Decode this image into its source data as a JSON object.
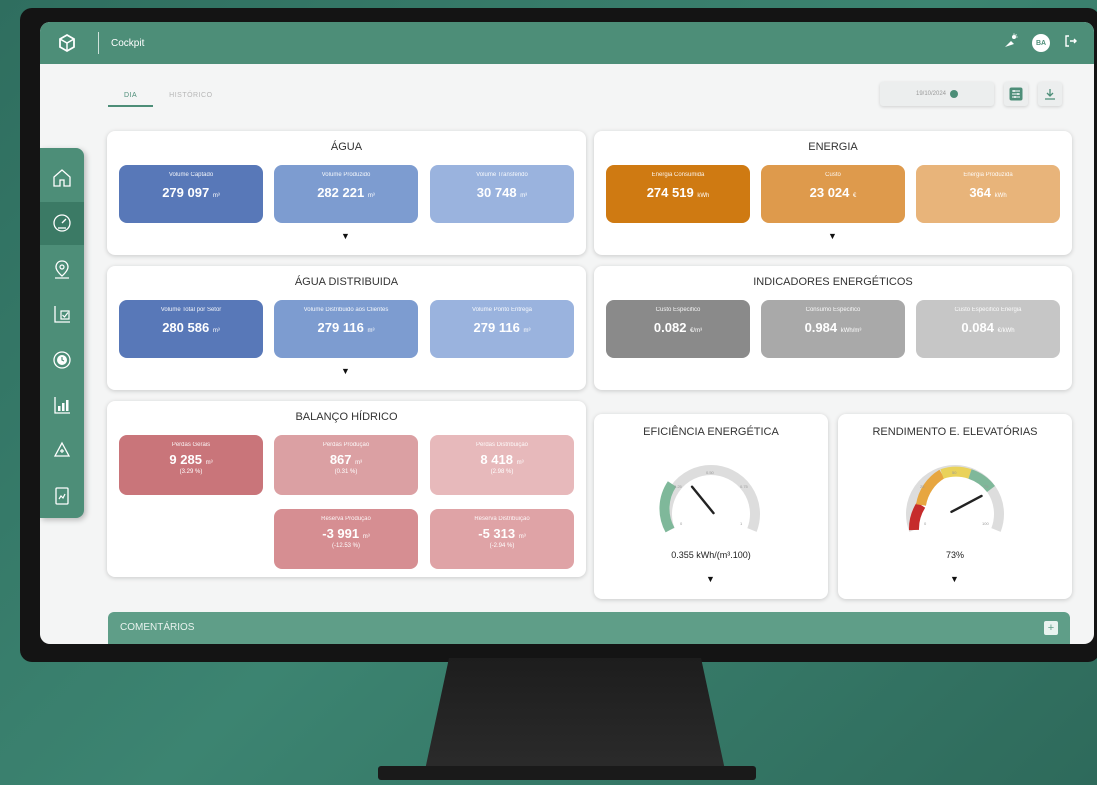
{
  "app": {
    "title": "Cockpit",
    "user_initials": "BA"
  },
  "tabs": [
    {
      "label": "DIA"
    },
    {
      "label": "HISTÓRICO"
    }
  ],
  "date": "19/10/2024",
  "agua": {
    "title": "ÁGUA",
    "cards": [
      {
        "label": "Volume Captado",
        "value": "279 097",
        "unit": "m³"
      },
      {
        "label": "Volume Produzido",
        "value": "282 221",
        "unit": "m³"
      },
      {
        "label": "Volume Transferido",
        "value": "30 748",
        "unit": "m³"
      }
    ]
  },
  "energia": {
    "title": "ENERGIA",
    "cards": [
      {
        "label": "Energia Consumida",
        "value": "274 519",
        "unit": "kWh"
      },
      {
        "label": "Custo",
        "value": "23 024",
        "unit": "€"
      },
      {
        "label": "Energia Produzida",
        "value": "364",
        "unit": "kWh"
      }
    ]
  },
  "agua_dist": {
    "title": "ÁGUA DISTRIBUIDA",
    "cards": [
      {
        "label": "Volume Total por Setor",
        "value": "280 586",
        "unit": "m³"
      },
      {
        "label": "Volume Distribuido aos Clientes",
        "value": "279 116",
        "unit": "m³"
      },
      {
        "label": "Volume Ponto Entrega",
        "value": "279 116",
        "unit": "m³"
      }
    ]
  },
  "indicadores": {
    "title": "INDICADORES ENERGÉTICOS",
    "cards": [
      {
        "label": "Custo Especifico",
        "value": "0.082",
        "unit": "€/m³"
      },
      {
        "label": "Consumo Especifico",
        "value": "0.984",
        "unit": "kWh/m³"
      },
      {
        "label": "Custo Especifico Energia",
        "value": "0.084",
        "unit": "€/kWh"
      }
    ]
  },
  "balanco": {
    "title": "BALANÇO HÍDRICO",
    "cards": [
      {
        "label": "Perdas Gerais",
        "value": "9 285",
        "unit": "m³",
        "pct": "(3.29 %)"
      },
      {
        "label": "Perdas Produção",
        "value": "867",
        "unit": "m³",
        "pct": "(0.31 %)"
      },
      {
        "label": "Perdas Distribuição",
        "value": "8 418",
        "unit": "m³",
        "pct": "(2.98 %)"
      },
      {
        "label": "Reserva Produção",
        "value": "-3 991",
        "unit": "m³",
        "pct": "(-12.53 %)"
      },
      {
        "label": "Reserva Distribuição",
        "value": "-5 313",
        "unit": "m³",
        "pct": "(-2.94 %)"
      }
    ]
  },
  "eficiencia": {
    "title": "EFICIÊNCIA ENERGÉTICA",
    "value_text": "0.355 kWh/(m³.100)",
    "value": 0.355,
    "ticks": [
      "0",
      "0.25",
      "0.50",
      "0.75",
      "1"
    ]
  },
  "rendimento": {
    "title": "RENDIMENTO E. ELEVATÓRIAS",
    "value_text": "73%",
    "value": 73,
    "ticks": [
      "0",
      "25",
      "50",
      "75",
      "100"
    ]
  },
  "comments": {
    "label": "COMENTÁRIOS",
    "add": "+"
  },
  "down_arrow": "▼",
  "colors": {
    "brand": "#4d8e78",
    "water": [
      "#5878b8",
      "#7d9cd0",
      "#9ab3de"
    ],
    "energy": [
      "#cf7a12",
      "#de9a4c",
      "#e8b47a"
    ],
    "indicators": [
      "#8a8a8a",
      "#a9a9a9",
      "#c6c6c6"
    ],
    "balance": [
      "#c9757a",
      "#dba0a3",
      "#e7b9bb",
      "#d68e92",
      "#dfa3a6"
    ]
  }
}
